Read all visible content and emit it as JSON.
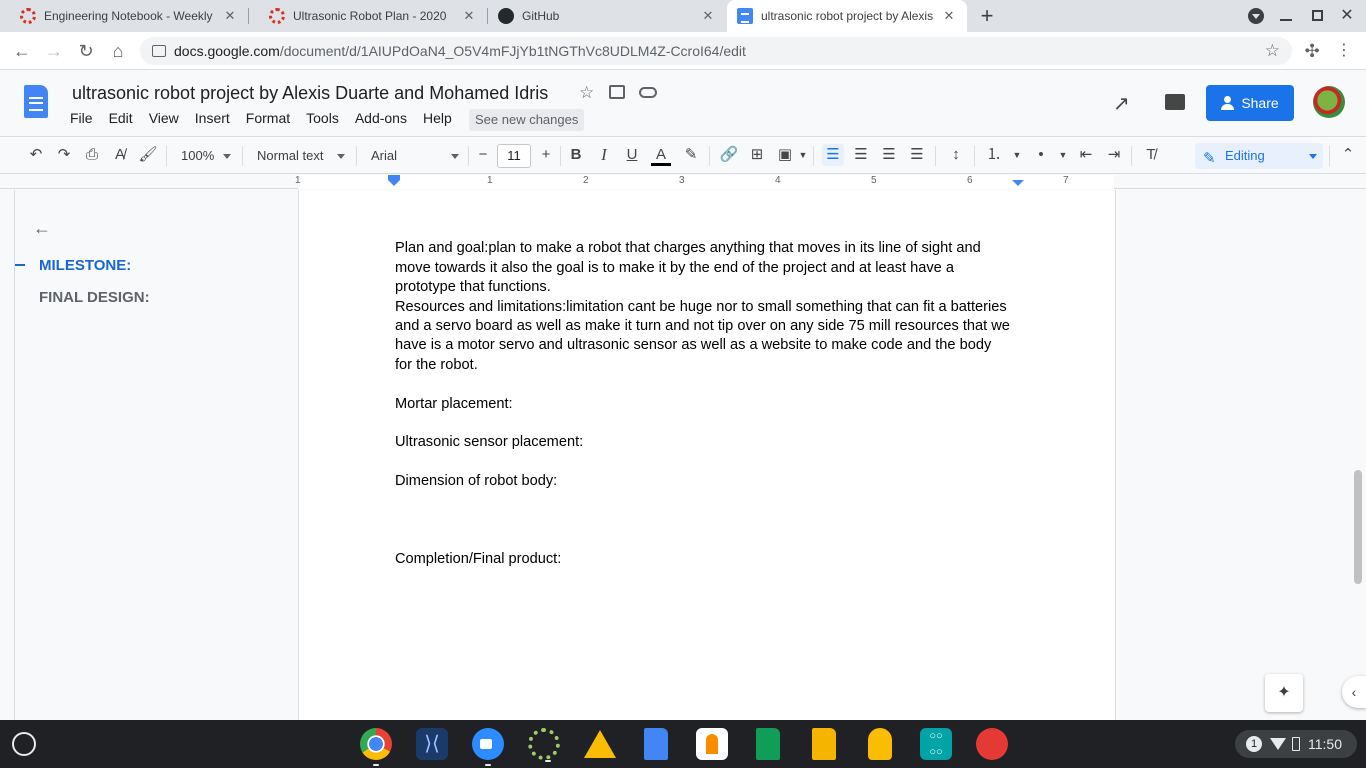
{
  "browser": {
    "tabs": [
      {
        "title": "Engineering Notebook - Weekly",
        "active": false
      },
      {
        "title": "Ultrasonic Robot Plan - 2020",
        "active": false
      },
      {
        "title": "GitHub",
        "active": false
      },
      {
        "title": "ultrasonic robot project by Alexis",
        "active": true
      }
    ],
    "new_tab": "+",
    "url_host": "docs.google.com",
    "url_path": "/document/d/1AIUPdOaN4_O5V4mFJjYb1tNGThVc8UDLM4Z-CcroI64/edit"
  },
  "docs": {
    "title": "ultrasonic robot project by Alexis Duarte and Mohamed Idris",
    "menu": [
      "File",
      "Edit",
      "View",
      "Insert",
      "Format",
      "Tools",
      "Add-ons",
      "Help"
    ],
    "see_new_changes": "See new changes",
    "share_label": "Share"
  },
  "toolbar": {
    "zoom": "100%",
    "style": "Normal text",
    "font": "Arial",
    "font_size": "11",
    "mode": "Editing"
  },
  "ruler": [
    "1",
    "1",
    "2",
    "3",
    "4",
    "5",
    "6",
    "7"
  ],
  "outline": {
    "items": [
      {
        "label": "MILESTONE:",
        "active": true
      },
      {
        "label": "FINAL DESIGN:",
        "active": false
      }
    ]
  },
  "document": {
    "paragraphs": [
      "Plan and goal:plan to  make a robot that charges anything that moves in its line of sight and",
      "move towards it also the goal is to make it by the end of the project and at least have a",
      "prototype that functions.",
      "Resources and limitations:limitation cant be huge nor to small something that can fit a batteries",
      "and a servo board as well as make it turn and not tip over on any side 75 mill resources that we",
      "have is a motor servo and  ultrasonic sensor as well as a website to make code and the body",
      "for the robot.",
      "Mortar placement:",
      "Ultrasonic sensor placement:",
      "Dimension of robot body:",
      "Completion/Final product:"
    ]
  },
  "system": {
    "notification_count": "1",
    "time": "11:50"
  }
}
